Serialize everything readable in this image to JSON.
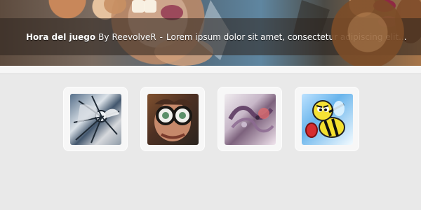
{
  "slider": {
    "title": "Hora del juego",
    "by_label": "By",
    "author": "ReevolveR",
    "separator": "-",
    "description": "Lorem ipsum dolor sit amet, consectetur adipiscing elit..."
  },
  "thumbnails": [
    {
      "name": "thumbnail-1"
    },
    {
      "name": "thumbnail-2"
    },
    {
      "name": "thumbnail-3"
    },
    {
      "name": "thumbnail-4"
    }
  ]
}
